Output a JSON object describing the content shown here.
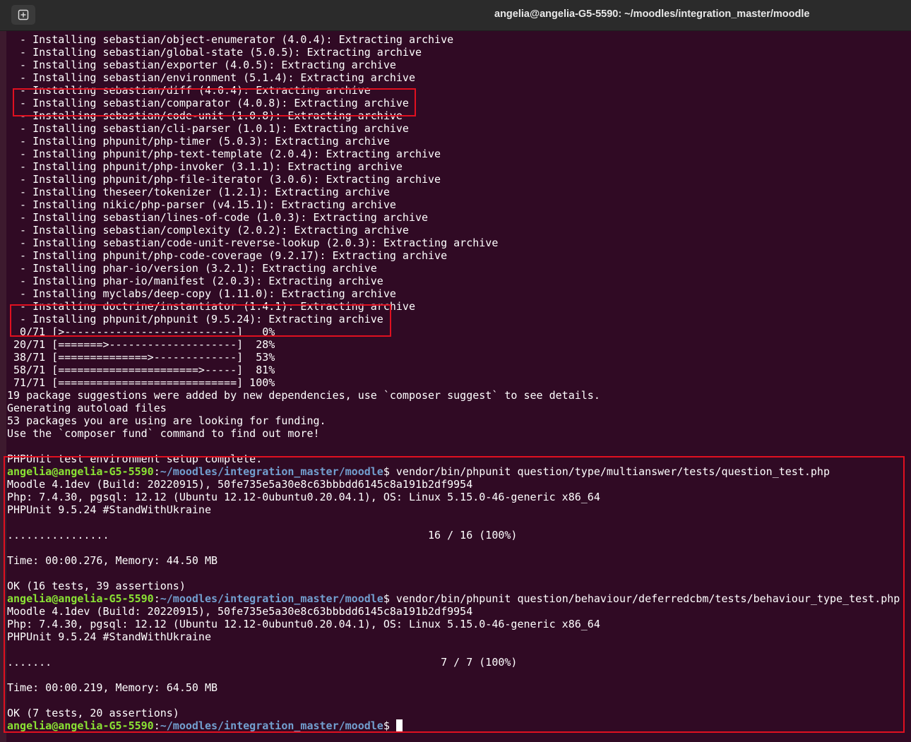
{
  "window": {
    "title": "angelia@angelia-G5-5590: ~/moodles/integration_master/moodle",
    "new_tab_icon": "new-tab-icon"
  },
  "prompt": {
    "user_host": "angelia@angelia-G5-5590",
    "colon": ":",
    "path": "~/moodles/integration_master/moodle",
    "dollar": "$"
  },
  "terminal": {
    "output_lines": [
      "  - Installing sebastian/object-enumerator (4.0.4): Extracting archive",
      "  - Installing sebastian/global-state (5.0.5): Extracting archive",
      "  - Installing sebastian/exporter (4.0.5): Extracting archive",
      "  - Installing sebastian/environment (5.1.4): Extracting archive",
      "  - Installing sebastian/diff (4.0.4): Extracting archive",
      "  - Installing sebastian/comparator (4.0.8): Extracting archive",
      "  - Installing sebastian/code-unit (1.0.8): Extracting archive",
      "  - Installing sebastian/cli-parser (1.0.1): Extracting archive",
      "  - Installing phpunit/php-timer (5.0.3): Extracting archive",
      "  - Installing phpunit/php-text-template (2.0.4): Extracting archive",
      "  - Installing phpunit/php-invoker (3.1.1): Extracting archive",
      "  - Installing phpunit/php-file-iterator (3.0.6): Extracting archive",
      "  - Installing theseer/tokenizer (1.2.1): Extracting archive",
      "  - Installing nikic/php-parser (v4.15.1): Extracting archive",
      "  - Installing sebastian/lines-of-code (1.0.3): Extracting archive",
      "  - Installing sebastian/complexity (2.0.2): Extracting archive",
      "  - Installing sebastian/code-unit-reverse-lookup (2.0.3): Extracting archive",
      "  - Installing phpunit/php-code-coverage (9.2.17): Extracting archive",
      "  - Installing phar-io/version (3.2.1): Extracting archive",
      "  - Installing phar-io/manifest (2.0.3): Extracting archive",
      "  - Installing myclabs/deep-copy (1.11.0): Extracting archive",
      "  - Installing doctrine/instantiator (1.4.1): Extracting archive",
      "  - Installing phpunit/phpunit (9.5.24): Extracting archive",
      "  0/71 [>---------------------------]   0%",
      " 20/71 [=======>--------------------]  28%",
      " 38/71 [==============>-------------]  53%",
      " 58/71 [======================>-----]  81%",
      " 71/71 [============================] 100%",
      "19 package suggestions were added by new dependencies, use `composer suggest` to see details.",
      "Generating autoload files",
      "53 packages you are using are looking for funding.",
      "Use the `composer fund` command to find out more!",
      "",
      "PHPUnit test environment setup complete."
    ],
    "run1": {
      "command": " vendor/bin/phpunit question/type/multianswer/tests/question_test.php",
      "lines": [
        "Moodle 4.1dev (Build: 20220915), 50fe735e5a30e8c63bbbdd6145c8a191b2df9954",
        "Php: 7.4.30, pgsql: 12.12 (Ubuntu 12.12-0ubuntu0.20.04.1), OS: Linux 5.15.0-46-generic x86_64",
        "PHPUnit 9.5.24 #StandWithUkraine",
        "",
        "................                                                  16 / 16 (100%)",
        "",
        "Time: 00:00.276, Memory: 44.50 MB",
        "",
        "OK (16 tests, 39 assertions)"
      ]
    },
    "run2": {
      "command": " vendor/bin/phpunit question/behaviour/deferredcbm/tests/behaviour_type_test.php",
      "lines": [
        "Moodle 4.1dev (Build: 20220915), 50fe735e5a30e8c63bbbdd6145c8a191b2df9954",
        "Php: 7.4.30, pgsql: 12.12 (Ubuntu 12.12-0ubuntu0.20.04.1), OS: Linux 5.15.0-46-generic x86_64",
        "PHPUnit 9.5.24 #StandWithUkraine",
        "",
        ".......                                                             7 / 7 (100%)",
        "",
        "Time: 00:00.219, Memory: 64.50 MB",
        "",
        "OK (7 tests, 20 assertions)"
      ]
    },
    "final_command": " "
  },
  "colors": {
    "background": "#300a24",
    "prompt_user": "#8ae234",
    "prompt_path": "#729fcf",
    "highlight_box": "#e01020"
  }
}
